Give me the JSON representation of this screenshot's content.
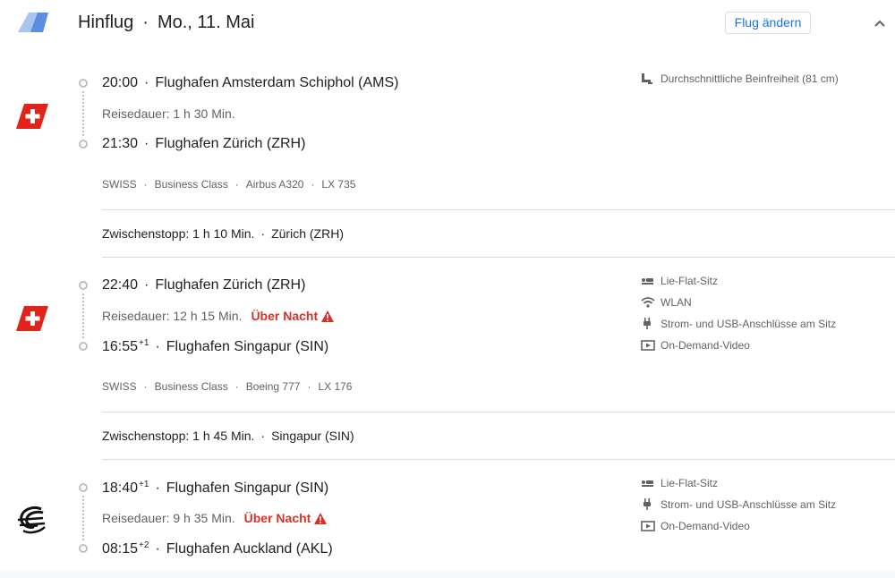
{
  "header": {
    "title": "Hinflug",
    "date": "Mo., 11. Mai",
    "change_button": "Flug ändern"
  },
  "legs": [
    {
      "airline_logo": "swiss-logo",
      "departure": {
        "time": "20:00",
        "day_offset": "",
        "airport": "Flughafen Amsterdam Schiphol (AMS)"
      },
      "duration": "Reisedauer: 1 h 30 Min.",
      "overnight": "",
      "arrival": {
        "time": "21:30",
        "day_offset": "",
        "airport": "Flughafen Zürich (ZRH)"
      },
      "details": {
        "airline": "SWISS",
        "cabin": "Business Class",
        "aircraft": "Airbus A320",
        "flight_number": "LX 735"
      },
      "amenities": [
        {
          "icon": "legroom-icon",
          "label": "Durchschnittliche Beinfreiheit (81 cm)"
        }
      ]
    },
    {
      "airline_logo": "swiss-logo",
      "departure": {
        "time": "22:40",
        "day_offset": "",
        "airport": "Flughafen Zürich (ZRH)"
      },
      "duration": "Reisedauer: 12 h 15 Min.",
      "overnight": "Über Nacht",
      "arrival": {
        "time": "16:55",
        "day_offset": "+1",
        "airport": "Flughafen Singapur (SIN)"
      },
      "details": {
        "airline": "SWISS",
        "cabin": "Business Class",
        "aircraft": "Boeing 777",
        "flight_number": "LX 176"
      },
      "amenities": [
        {
          "icon": "lie-flat-seat-icon",
          "label": "Lie-Flat-Sitz"
        },
        {
          "icon": "wifi-icon",
          "label": "WLAN"
        },
        {
          "icon": "power-plug-icon",
          "label": "Strom- und USB-Anschlüsse am Sitz"
        },
        {
          "icon": "video-icon",
          "label": "On-Demand-Video"
        }
      ]
    },
    {
      "airline_logo": "air-new-zealand-logo",
      "departure": {
        "time": "18:40",
        "day_offset": "+1",
        "airport": "Flughafen Singapur (SIN)"
      },
      "duration": "Reisedauer: 9 h 35 Min.",
      "overnight": "Über Nacht",
      "arrival": {
        "time": "08:15",
        "day_offset": "+2",
        "airport": "Flughafen Auckland (AKL)"
      },
      "amenities": [
        {
          "icon": "lie-flat-seat-icon",
          "label": "Lie-Flat-Sitz"
        },
        {
          "icon": "power-plug-icon",
          "label": "Strom- und USB-Anschlüsse am Sitz"
        },
        {
          "icon": "video-icon",
          "label": "On-Demand-Video"
        }
      ]
    }
  ],
  "layovers": [
    {
      "duration": "Zwischenstopp: 1 h 10 Min.",
      "airport": "Zürich (ZRH)"
    },
    {
      "duration": "Zwischenstopp: 1 h 45 Min.",
      "airport": "Singapur (SIN)"
    }
  ],
  "colors": {
    "accent": "#1a73e8",
    "overnight_warning": "#d93025",
    "swiss_red": "#e2231a"
  }
}
